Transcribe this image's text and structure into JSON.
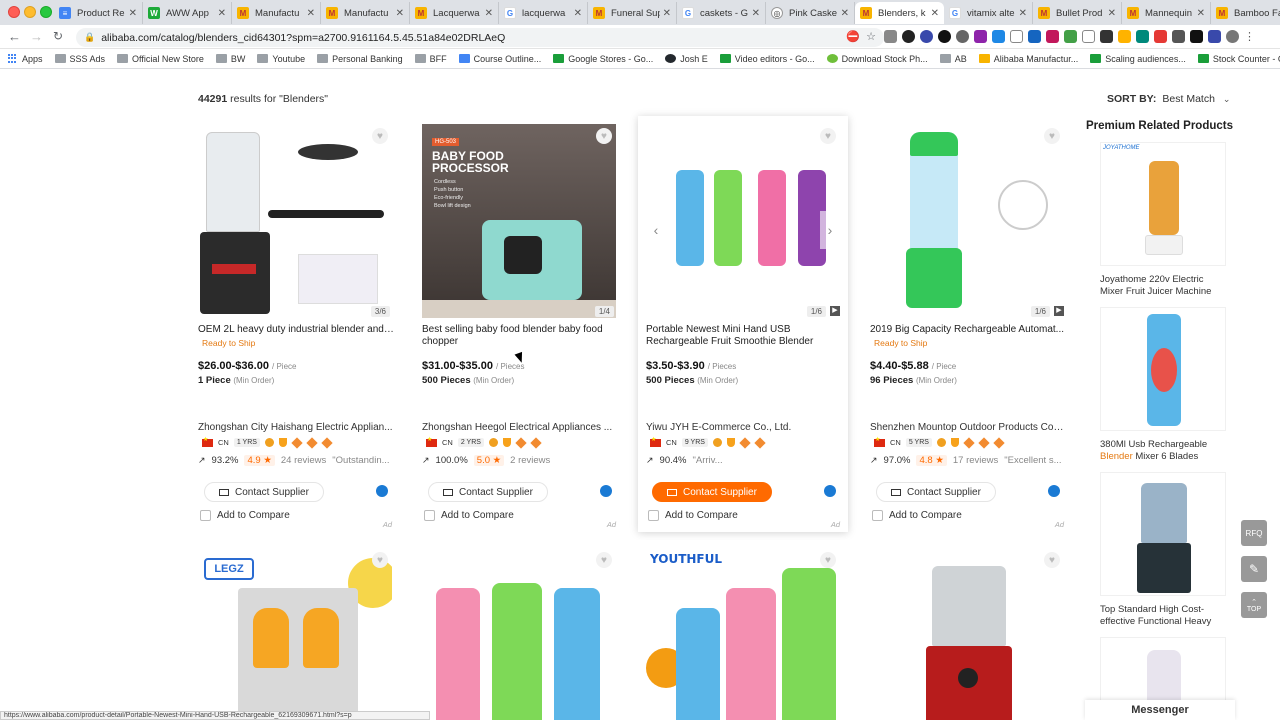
{
  "browser": {
    "tabs": [
      {
        "title": "Product Re",
        "icon": "docs"
      },
      {
        "title": "AWW App",
        "icon": "green"
      },
      {
        "title": "Manufactu",
        "icon": "ali"
      },
      {
        "title": "Manufactu",
        "icon": "ali"
      },
      {
        "title": "Lacquerwa",
        "icon": "ali"
      },
      {
        "title": "lacquerwa",
        "icon": "g"
      },
      {
        "title": "Funeral Sup",
        "icon": "ali"
      },
      {
        "title": "caskets - G",
        "icon": "g"
      },
      {
        "title": "Pink Caske",
        "icon": "globe"
      },
      {
        "title": "Blenders, k",
        "icon": "ali",
        "active": true
      },
      {
        "title": "vitamix alte",
        "icon": "g"
      },
      {
        "title": "Bullet Prod",
        "icon": "ali"
      },
      {
        "title": "Mannequin",
        "icon": "ali"
      },
      {
        "title": "Bamboo Fa",
        "icon": "ali"
      }
    ],
    "url": "alibaba.com/catalog/blenders_cid64301?spm=a2700.9161164.5.45.51a84e02DRLAeQ",
    "bookmarks": [
      {
        "label": "Apps",
        "icon": "apps"
      },
      {
        "label": "SSS Ads",
        "icon": "folder"
      },
      {
        "label": "Official New Store",
        "icon": "folder"
      },
      {
        "label": "BW",
        "icon": "folder"
      },
      {
        "label": "Youtube",
        "icon": "folder"
      },
      {
        "label": "Personal Banking",
        "icon": "folder"
      },
      {
        "label": "BFF",
        "icon": "folder"
      },
      {
        "label": "Course Outline...",
        "icon": "docs"
      },
      {
        "label": "Google Stores - Go...",
        "icon": "plus"
      },
      {
        "label": "Josh E",
        "icon": "github"
      },
      {
        "label": "Video editors - Go...",
        "icon": "plus"
      },
      {
        "label": "Download Stock Ph...",
        "icon": "download"
      },
      {
        "label": "AB",
        "icon": "folder"
      },
      {
        "label": "Alibaba Manufactur...",
        "icon": "ali"
      },
      {
        "label": "Scaling audiences...",
        "icon": "plus"
      },
      {
        "label": "Stock Counter - Go...",
        "icon": "plus"
      }
    ],
    "status_url": "https://www.alibaba.com/product-detail/Portable-Newest-Mini-Hand-USB-Rechargeable_62169309671.html?s=p"
  },
  "results": {
    "count": "44291",
    "suffix": "results for \"Blenders\""
  },
  "sort": {
    "label": "SORT BY:",
    "value": "Best Match"
  },
  "products": [
    {
      "title": "OEM 2L heavy duty industrial blender and ...",
      "ready_to_ship": "Ready to Ship",
      "price": "$26.00-$36.00",
      "unit": "/ Piece",
      "moq": "1 Piece",
      "moq_note": "(Min Order)",
      "image_count": "3/6",
      "supplier": "Zhongshan City Haishang Electric Applian...",
      "country": "CN",
      "years": "1 YRS",
      "response_rate": "93.2%",
      "rating": "4.9 ★",
      "reviews": "24 reviews",
      "quote": "\"Outstandin...",
      "contact_label": "Contact Supplier",
      "compare_label": "Add to Compare",
      "ad_label": "Ad"
    },
    {
      "title": "Best selling baby food blender baby food chopper",
      "ready_to_ship": "",
      "price": "$31.00-$35.00",
      "unit": "/ Pieces",
      "moq": "500 Pieces",
      "moq_note": "(Min Order)",
      "image_count": "1/4",
      "supplier": "Zhongshan Heegol Electrical Appliances ...",
      "country": "CN",
      "years": "2 YRS",
      "response_rate": "100.0%",
      "rating": "5.0 ★",
      "reviews": "2 reviews",
      "quote": "",
      "contact_label": "Contact Supplier",
      "compare_label": "Add to Compare",
      "ad_label": "Ad",
      "image_text": {
        "tag": "HG-503",
        "headline": "BABY FOOD PROCESSOR",
        "features": [
          "Cordless",
          "Push button",
          "Eco-friendly",
          "Bowl lift design"
        ]
      }
    },
    {
      "title": "Portable Newest Mini Hand USB Rechargeable Fruit Smoothie Blender",
      "ready_to_ship": "",
      "price": "$3.50-$3.90",
      "unit": "/ Pieces",
      "moq": "500 Pieces",
      "moq_note": "(Min Order)",
      "image_count": "1/6",
      "supplier": "Yiwu JYH E-Commerce Co., Ltd.",
      "country": "CN",
      "years": "9 YRS",
      "response_rate": "90.4%",
      "rating": "",
      "reviews": "",
      "quote": "\"Arriv...",
      "contact_label": "Contact Supplier",
      "compare_label": "Add to Compare",
      "ad_label": "Ad"
    },
    {
      "title": "2019 Big Capacity Rechargeable Automat...",
      "ready_to_ship": "Ready to Ship",
      "price": "$4.40-$5.88",
      "unit": "/ Piece",
      "moq": "96 Pieces",
      "moq_note": "(Min Order)",
      "image_count": "1/6",
      "supplier": "Shenzhen Mountop Outdoor Products Co.,...",
      "country": "CN",
      "years": "5 YRS",
      "response_rate": "97.0%",
      "rating": "4.8 ★",
      "reviews": "17 reviews",
      "quote": "\"Excellent s...",
      "contact_label": "Contact Supplier",
      "compare_label": "Add to Compare",
      "ad_label": "Ad"
    }
  ],
  "second_row": {
    "brand_text": "YOUTHFUL",
    "logo_text": "LEGZ"
  },
  "premium": {
    "title": "Premium Related Products",
    "items": [
      {
        "brand": "JOYATHOME",
        "caption": "Joyathome 220v Electric Mixer Fruit Juicer Machine",
        "highlight": ""
      },
      {
        "brand": "",
        "caption_pre": "380Ml Usb Rechargeable",
        "highlight": "Blender",
        "caption_post": "Mixer 6 Blades"
      },
      {
        "brand": "",
        "caption": "Top Standard High Cost-effective Functional Heavy",
        "highlight": ""
      }
    ]
  },
  "fabs": {
    "rfq": "RFQ",
    "top": "TOP"
  },
  "messenger": "Messenger",
  "colors": {
    "accent": "#ff6a00",
    "ready": "#e47911",
    "link_blue": "#1a7ad4"
  }
}
